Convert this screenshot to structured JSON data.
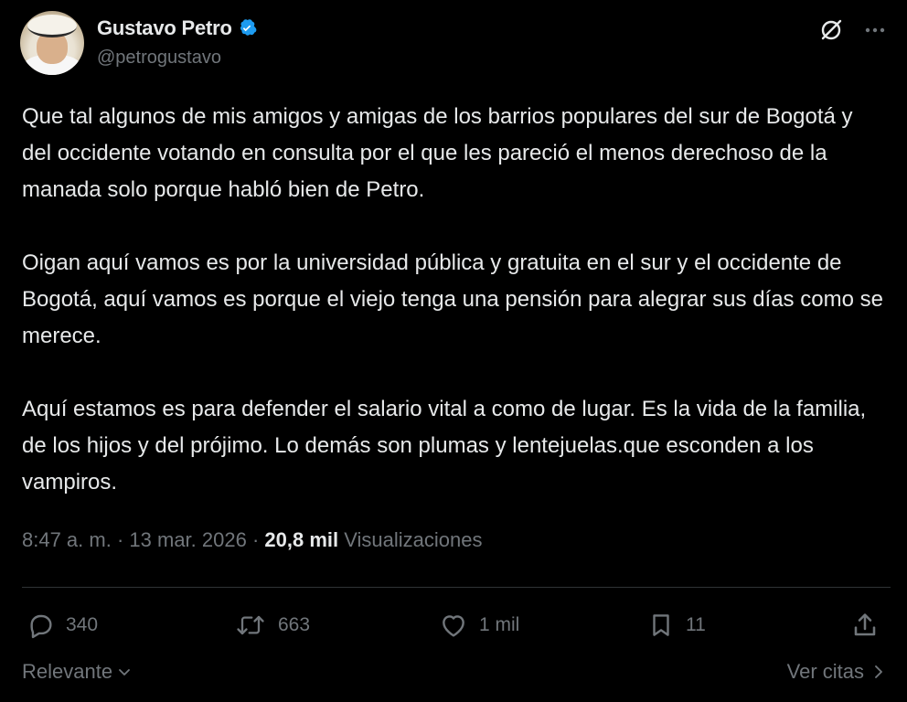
{
  "author": {
    "display_name": "Gustavo Petro",
    "handle": "@petrogustavo",
    "verified": true
  },
  "header_icons": [
    "grok-icon",
    "more-options-icon"
  ],
  "tweet": {
    "paragraphs": [
      "Que tal algunos de mis amigos y amigas de los barrios populares del sur de Bogotá y del occidente votando en consulta por el que les pareció el menos derechoso de la manada solo porque habló bien de Petro.",
      "Oigan aquí vamos es por la universidad pública y gratuita en el sur y el occidente de Bogotá, aquí vamos es porque el viejo tenga una pensión para alegrar sus días como se merece.",
      "Aquí estamos es para defender el salario vital a como de lugar. Es la vida de la familia, de los hijos y del prójimo. Lo demás son plumas y lentejuelas.que esconden a los vampiros."
    ]
  },
  "meta": {
    "time": "8:47 a. m.",
    "separator": " · ",
    "date": "13 mar. 2026",
    "views_count": "20,8 mil",
    "views_label": "Visualizaciones"
  },
  "actions": {
    "replies": "340",
    "reposts": "663",
    "likes": "1 mil",
    "bookmarks": "11"
  },
  "footer": {
    "sort_label": "Relevante",
    "quotes_label": "Ver citas"
  },
  "colors": {
    "background": "#000000",
    "text_primary": "#e7e9ea",
    "text_secondary": "#71767b",
    "verified_blue": "#1d9bf0",
    "divider": "#2f3336"
  }
}
